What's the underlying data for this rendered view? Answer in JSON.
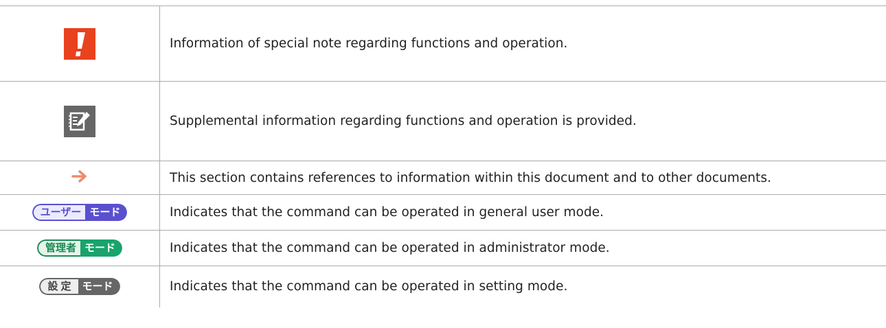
{
  "rows": [
    {
      "icon": "warning-exclamation-icon",
      "text": "Information of special note regarding functions and operation."
    },
    {
      "icon": "note-pencil-icon",
      "text": "Supplemental information regarding functions and operation is provided."
    },
    {
      "icon": "reference-arrow-icon",
      "text": "This section contains references to information within this document and to other documents."
    },
    {
      "icon": "user-mode-badge",
      "badge_left": "ユーザー",
      "badge_right": "モード",
      "text": "Indicates that the command can be operated in general user mode."
    },
    {
      "icon": "administrator-mode-badge",
      "badge_left": "管理者",
      "badge_right": "モード",
      "text": "Indicates that the command can be operated in administrator mode."
    },
    {
      "icon": "setting-mode-badge",
      "badge_left": "設定",
      "badge_right": "モード",
      "text": "Indicates that the command can be operated in setting mode."
    }
  ],
  "colors": {
    "warning": "#e8421e",
    "note": "#666666",
    "arrow": "#f08a6a",
    "user_mode": "#5a4fcf",
    "admin_mode": "#18a46b",
    "setting_mode": "#666666",
    "border": "#aaaaaa"
  }
}
